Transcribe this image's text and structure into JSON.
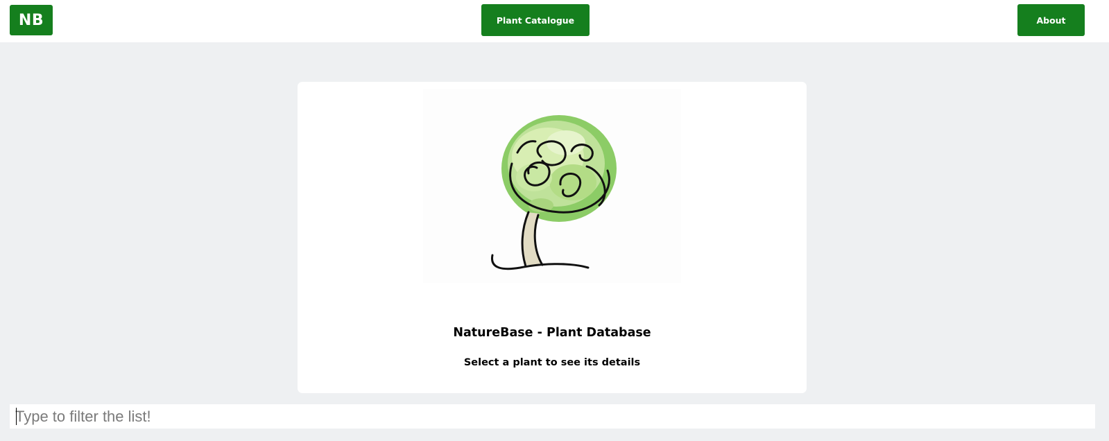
{
  "navbar": {
    "logo_label": "NB",
    "catalogue_label": "Plant Catalogue",
    "about_label": "About"
  },
  "colors": {
    "brand_green": "#157f1e",
    "page_background": "#eef0f2",
    "tree_foliage": "#8ccc66"
  },
  "main": {
    "illustration_icon": "tree-icon",
    "title": "NatureBase - Plant Database",
    "subtitle": "Select a plant to see its details"
  },
  "filter": {
    "placeholder": "Type to filter the list!",
    "value": ""
  }
}
